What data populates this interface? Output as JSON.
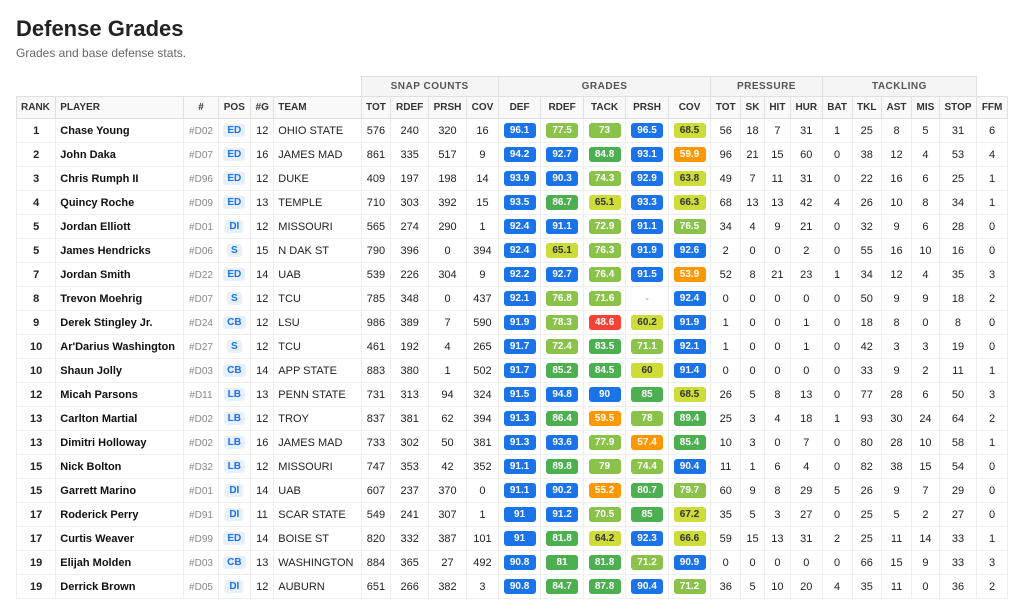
{
  "title": "Defense Grades",
  "subtitle": "Grades and base defense stats.",
  "rows": [
    {
      "rank": 1,
      "player": "Chase Young",
      "num": "#D02",
      "pos": "ED",
      "g": 12,
      "team": "OHIO STATE",
      "tot": 576,
      "rdef": 240,
      "prsh": 320,
      "cov": 16,
      "def": 96.1,
      "def_color": "blue",
      "rdef_g": 77.5,
      "rdef_color": "green",
      "tack": 73.0,
      "tack_color": "yellow-green",
      "prsh_g": 96.5,
      "prsh_color": "blue",
      "cov_g": 68.5,
      "cov_color": "yellow-green",
      "ptot": 56,
      "sk": 18,
      "hit": 7,
      "hur": 31,
      "bat": 1,
      "tkl": 25,
      "ast": 8,
      "mis": 5,
      "stop": 31,
      "ffm": 6
    },
    {
      "rank": 2,
      "player": "John Daka",
      "num": "#D07",
      "pos": "ED",
      "g": 16,
      "team": "JAMES MAD",
      "tot": 861,
      "rdef": 335,
      "prsh": 517,
      "cov": 9,
      "def": 94.2,
      "def_color": "blue",
      "rdef_g": 92.7,
      "rdef_color": "blue",
      "tack": 84.8,
      "tack_color": "green",
      "prsh_g": 93.1,
      "prsh_color": "blue",
      "cov_g": 59.9,
      "cov_color": "orange",
      "ptot": 96,
      "sk": 21,
      "hit": 15,
      "hur": 60,
      "bat": 0,
      "tkl": 38,
      "ast": 12,
      "mis": 4,
      "stop": 53,
      "ffm": 4
    },
    {
      "rank": 3,
      "player": "Chris Rumph II",
      "num": "#D96",
      "pos": "ED",
      "g": 12,
      "team": "DUKE",
      "tot": 409,
      "rdef": 197,
      "prsh": 198,
      "cov": 14,
      "def": 93.9,
      "def_color": "blue",
      "rdef_g": 90.3,
      "rdef_color": "blue",
      "tack": 74.3,
      "tack_color": "yellow-green",
      "prsh_g": 92.9,
      "prsh_color": "blue",
      "cov_g": 63.8,
      "cov_color": "yellow-green",
      "ptot": 49,
      "sk": 7,
      "hit": 11,
      "hur": 31,
      "bat": 0,
      "tkl": 22,
      "ast": 16,
      "mis": 6,
      "stop": 25,
      "ffm": 1
    },
    {
      "rank": 4,
      "player": "Quincy Roche",
      "num": "#D09",
      "pos": "ED",
      "g": 13,
      "team": "TEMPLE",
      "tot": 710,
      "rdef": 303,
      "prsh": 392,
      "cov": 15,
      "def": 93.5,
      "def_color": "blue",
      "rdef_g": 86.7,
      "rdef_color": "green",
      "tack": 65.1,
      "tack_color": "yellow",
      "prsh_g": 93.3,
      "prsh_color": "blue",
      "cov_g": 66.3,
      "cov_color": "yellow-green",
      "ptot": 68,
      "sk": 13,
      "hit": 13,
      "hur": 42,
      "bat": 4,
      "tkl": 26,
      "ast": 10,
      "mis": 8,
      "stop": 34,
      "ffm": 1
    },
    {
      "rank": 5,
      "player": "Jordan Elliott",
      "num": "#D01",
      "pos": "DI",
      "g": 12,
      "team": "MISSOURI",
      "tot": 565,
      "rdef": 274,
      "prsh": 290,
      "cov": 1,
      "def": 92.4,
      "def_color": "blue",
      "rdef_g": 91.1,
      "rdef_color": "blue",
      "tack": 72.9,
      "tack_color": "yellow-green",
      "prsh_g": 91.1,
      "prsh_color": "blue",
      "cov_g": 76.5,
      "cov_color": "green",
      "ptot": 34,
      "sk": 4,
      "hit": 9,
      "hur": 21,
      "bat": 0,
      "tkl": 32,
      "ast": 9,
      "mis": 6,
      "stop": 28,
      "ffm": 0
    },
    {
      "rank": 5,
      "player": "James Hendricks",
      "num": "#D06",
      "pos": "S",
      "g": 15,
      "team": "N DAK ST",
      "tot": 790,
      "rdef": 396,
      "prsh": 0,
      "cov": 394,
      "def": 92.4,
      "def_color": "blue",
      "rdef_g": 65.1,
      "rdef_color": "yellow",
      "tack": 76.3,
      "tack_color": "green",
      "prsh_g": 91.9,
      "prsh_color": "blue",
      "cov_g": 92.6,
      "cov_color": "blue",
      "ptot": 2,
      "sk": 0,
      "hit": 0,
      "hur": 2,
      "bat": 0,
      "tkl": 55,
      "ast": 16,
      "mis": 10,
      "stop": 16,
      "ffm": 0
    },
    {
      "rank": 7,
      "player": "Jordan Smith",
      "num": "#D22",
      "pos": "ED",
      "g": 14,
      "team": "UAB",
      "tot": 539,
      "rdef": 226,
      "prsh": 304,
      "cov": 9,
      "def": 92.2,
      "def_color": "blue",
      "rdef_g": 92.7,
      "rdef_color": "blue",
      "tack": 76.4,
      "tack_color": "green",
      "prsh_g": 91.5,
      "prsh_color": "blue",
      "cov_g": 53.9,
      "cov_color": "orange",
      "ptot": 52,
      "sk": 8,
      "hit": 21,
      "hur": 23,
      "bat": 1,
      "tkl": 34,
      "ast": 12,
      "mis": 4,
      "stop": 35,
      "ffm": 3
    },
    {
      "rank": 8,
      "player": "Trevon Moehrig",
      "num": "#D07",
      "pos": "S",
      "g": 12,
      "team": "TCU",
      "tot": 785,
      "rdef": 348,
      "prsh": 0,
      "cov": 437,
      "def": 92.1,
      "def_color": "blue",
      "rdef_g": 76.8,
      "rdef_color": "green",
      "tack": 71.6,
      "tack_color": "yellow-green",
      "prsh_g": "-",
      "prsh_color": "",
      "cov_g": 92.4,
      "cov_color": "blue",
      "ptot": 0,
      "sk": 0,
      "hit": 0,
      "hur": 0,
      "bat": 0,
      "tkl": 50,
      "ast": 9,
      "mis": 9,
      "stop": 18,
      "ffm": 2
    },
    {
      "rank": 9,
      "player": "Derek Stingley Jr.",
      "num": "#D24",
      "pos": "CB",
      "g": 12,
      "team": "LSU",
      "tot": 986,
      "rdef": 389,
      "prsh": 7,
      "cov": 590,
      "def": 91.9,
      "def_color": "blue",
      "rdef_g": 78.3,
      "rdef_color": "green",
      "tack": 48.6,
      "tack_color": "red",
      "prsh_g": 60.2,
      "prsh_color": "yellow",
      "cov_g": 91.9,
      "cov_color": "blue",
      "ptot": 1,
      "sk": 0,
      "hit": 0,
      "hur": 1,
      "bat": 0,
      "tkl": 18,
      "ast": 8,
      "mis": 0,
      "stop": 8,
      "ffm": 0
    },
    {
      "rank": 10,
      "player": "Ar'Darius Washington",
      "num": "#D27",
      "pos": "S",
      "g": 12,
      "team": "TCU",
      "tot": 461,
      "rdef": 192,
      "prsh": 4,
      "cov": 265,
      "def": 91.7,
      "def_color": "blue",
      "rdef_g": 72.4,
      "rdef_color": "yellow-green",
      "tack": 83.5,
      "tack_color": "green",
      "prsh_g": 71.1,
      "prsh_color": "yellow-green",
      "cov_g": 92.1,
      "cov_color": "blue",
      "ptot": 1,
      "sk": 0,
      "hit": 0,
      "hur": 1,
      "bat": 0,
      "tkl": 42,
      "ast": 3,
      "mis": 3,
      "stop": 19,
      "ffm": 0
    },
    {
      "rank": 10,
      "player": "Shaun Jolly",
      "num": "#D03",
      "pos": "CB",
      "g": 14,
      "team": "APP STATE",
      "tot": 883,
      "rdef": 380,
      "prsh": 1,
      "cov": 502,
      "def": 91.7,
      "def_color": "blue",
      "rdef_g": 85.2,
      "rdef_color": "green",
      "tack": 84.5,
      "tack_color": "green",
      "prsh_g": 60.0,
      "prsh_color": "yellow",
      "cov_g": 91.4,
      "cov_color": "blue",
      "ptot": 0,
      "sk": 0,
      "hit": 0,
      "hur": 0,
      "bat": 0,
      "tkl": 33,
      "ast": 9,
      "mis": 2,
      "stop": 11,
      "ffm": 1
    },
    {
      "rank": 12,
      "player": "Micah Parsons",
      "num": "#D11",
      "pos": "LB",
      "g": 13,
      "team": "PENN STATE",
      "tot": 731,
      "rdef": 313,
      "prsh": 94,
      "cov": 324,
      "def": 91.5,
      "def_color": "blue",
      "rdef_g": 94.8,
      "rdef_color": "blue",
      "tack": 90.0,
      "tack_color": "blue",
      "prsh_g": 85.0,
      "prsh_color": "green",
      "cov_g": 68.5,
      "cov_color": "yellow-green",
      "ptot": 26,
      "sk": 5,
      "hit": 8,
      "hur": 13,
      "bat": 0,
      "tkl": 77,
      "ast": 28,
      "mis": 6,
      "stop": 50,
      "ffm": 3
    },
    {
      "rank": 13,
      "player": "Carlton Martial",
      "num": "#D02",
      "pos": "LB",
      "g": 12,
      "team": "TROY",
      "tot": 837,
      "rdef": 381,
      "prsh": 62,
      "cov": 394,
      "def": 91.3,
      "def_color": "blue",
      "rdef_g": 86.4,
      "rdef_color": "green",
      "tack": 59.5,
      "tack_color": "orange",
      "prsh_g": 78.0,
      "prsh_color": "green",
      "cov_g": 89.4,
      "cov_color": "green",
      "ptot": 25,
      "sk": 3,
      "hit": 4,
      "hur": 18,
      "bat": 1,
      "tkl": 93,
      "ast": 30,
      "mis": 24,
      "stop": 64,
      "ffm": 2
    },
    {
      "rank": 13,
      "player": "Dimitri Holloway",
      "num": "#D02",
      "pos": "LB",
      "g": 16,
      "team": "JAMES MAD",
      "tot": 733,
      "rdef": 302,
      "prsh": 50,
      "cov": 381,
      "def": 91.3,
      "def_color": "blue",
      "rdef_g": 93.6,
      "rdef_color": "blue",
      "tack": 77.9,
      "tack_color": "green",
      "prsh_g": 57.4,
      "prsh_color": "orange",
      "cov_g": 85.4,
      "cov_color": "green",
      "ptot": 10,
      "sk": 3,
      "hit": 0,
      "hur": 7,
      "bat": 0,
      "tkl": 80,
      "ast": 28,
      "mis": 10,
      "stop": 58,
      "ffm": 1
    },
    {
      "rank": 15,
      "player": "Nick Bolton",
      "num": "#D32",
      "pos": "LB",
      "g": 12,
      "team": "MISSOURI",
      "tot": 747,
      "rdef": 353,
      "prsh": 42,
      "cov": 352,
      "def": 91.1,
      "def_color": "blue",
      "rdef_g": 89.8,
      "rdef_color": "green",
      "tack": 79.0,
      "tack_color": "green",
      "prsh_g": 74.4,
      "prsh_color": "yellow-green",
      "cov_g": 90.4,
      "cov_color": "blue",
      "ptot": 11,
      "sk": 1,
      "hit": 6,
      "hur": 4,
      "bat": 0,
      "tkl": 82,
      "ast": 38,
      "mis": 15,
      "stop": 54,
      "ffm": 0
    },
    {
      "rank": 15,
      "player": "Garrett Marino",
      "num": "#D01",
      "pos": "DI",
      "g": 14,
      "team": "UAB",
      "tot": 607,
      "rdef": 237,
      "prsh": 370,
      "cov": 0,
      "def": 91.1,
      "def_color": "blue",
      "rdef_g": 90.2,
      "rdef_color": "blue",
      "tack": 55.2,
      "tack_color": "orange",
      "prsh_g": 80.7,
      "prsh_color": "green",
      "cov_g": 79.7,
      "cov_color": "green",
      "ptot": 60,
      "sk": 9,
      "hit": 8,
      "hur": 29,
      "bat": 5,
      "tkl": 26,
      "ast": 9,
      "mis": 7,
      "stop": 29,
      "ffm": 0
    },
    {
      "rank": 17,
      "player": "Roderick Perry",
      "num": "#D91",
      "pos": "DI",
      "g": 11,
      "team": "SCAR STATE",
      "tot": 549,
      "rdef": 241,
      "prsh": 307,
      "cov": 1,
      "def": 91.0,
      "def_color": "blue",
      "rdef_g": 91.2,
      "rdef_color": "blue",
      "tack": 70.5,
      "tack_color": "yellow-green",
      "prsh_g": 85.0,
      "prsh_color": "green",
      "cov_g": 67.2,
      "cov_color": "yellow-green",
      "ptot": 35,
      "sk": 5,
      "hit": 3,
      "hur": 27,
      "bat": 0,
      "tkl": 25,
      "ast": 5,
      "mis": 2,
      "stop": 27,
      "ffm": 0
    },
    {
      "rank": 17,
      "player": "Curtis Weaver",
      "num": "#D99",
      "pos": "ED",
      "g": 14,
      "team": "BOISE ST",
      "tot": 820,
      "rdef": 332,
      "prsh": 387,
      "cov": 101,
      "def": 91.0,
      "def_color": "blue",
      "rdef_g": 81.8,
      "rdef_color": "green",
      "tack": 64.2,
      "tack_color": "yellow",
      "prsh_g": 92.3,
      "prsh_color": "blue",
      "cov_g": 66.6,
      "cov_color": "yellow-green",
      "ptot": 59,
      "sk": 15,
      "hit": 13,
      "hur": 31,
      "bat": 2,
      "tkl": 25,
      "ast": 11,
      "mis": 14,
      "stop": 33,
      "ffm": 1
    },
    {
      "rank": 19,
      "player": "Elijah Molden",
      "num": "#D03",
      "pos": "CB",
      "g": 13,
      "team": "WASHINGTON",
      "tot": 884,
      "rdef": 365,
      "prsh": 27,
      "cov": 492,
      "def": 90.8,
      "def_color": "blue",
      "rdef_g": 81.0,
      "rdef_color": "green",
      "tack": 81.8,
      "tack_color": "green",
      "prsh_g": 71.2,
      "prsh_color": "yellow-green",
      "cov_g": 90.9,
      "cov_color": "blue",
      "ptot": 0,
      "sk": 0,
      "hit": 0,
      "hur": 0,
      "bat": 0,
      "tkl": 66,
      "ast": 15,
      "mis": 9,
      "stop": 33,
      "ffm": 3
    },
    {
      "rank": 19,
      "player": "Derrick Brown",
      "num": "#D05",
      "pos": "DI",
      "g": 12,
      "team": "AUBURN",
      "tot": 651,
      "rdef": 266,
      "prsh": 382,
      "cov": 3,
      "def": 90.8,
      "def_color": "blue",
      "rdef_g": 84.7,
      "rdef_color": "green",
      "tack": 87.8,
      "tack_color": "green",
      "prsh_g": 90.4,
      "prsh_color": "blue",
      "cov_g": 71.2,
      "cov_color": "yellow-green",
      "ptot": 36,
      "sk": 5,
      "hit": 10,
      "hur": 20,
      "bat": 4,
      "tkl": 35,
      "ast": 11,
      "mis": 0,
      "stop": 36,
      "ffm": 2
    }
  ]
}
